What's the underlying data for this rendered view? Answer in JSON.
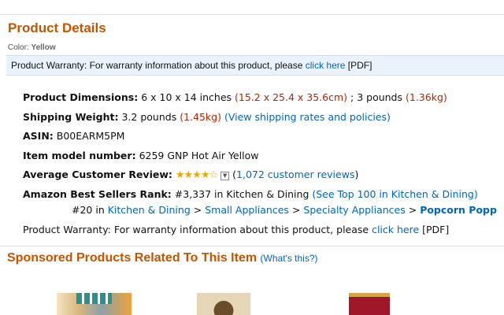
{
  "heading": "Product Details",
  "color": {
    "label": "Color:",
    "value": "Yellow"
  },
  "warranty_bar": {
    "prefix": "Product Warranty: For warranty information about this product, please",
    "link": "click here",
    "suffix": "[PDF]"
  },
  "details": {
    "dimensions": {
      "label": "Product Dimensions:",
      "value": "6 x 10 x 14 inches",
      "metric": "(15.2 x 25.4 x 35.6cm)",
      "sep": ";",
      "weight": "3 pounds",
      "weight_metric": "(1.36kg)"
    },
    "shipping": {
      "label": "Shipping Weight:",
      "value": "3.2 pounds",
      "metric": "(1.45kg)",
      "link": "(View shipping rates and policies)"
    },
    "asin": {
      "label": "ASIN:",
      "value": "B00EARM5PM"
    },
    "model": {
      "label": "Item model number:",
      "value": "6259 GNP Hot Air Yellow"
    },
    "review": {
      "label": "Average Customer Review:",
      "stars": "★★★★☆",
      "rating": 4,
      "count_prefix": "(",
      "count_link": "1,072 customer reviews",
      "count_suffix": ")"
    },
    "rank": {
      "label": "Amazon Best Sellers Rank:",
      "rank": "#3,337 in Kitchen & Dining",
      "link": "(See Top 100 in Kitchen & Dining)",
      "sub_rank": "#20 in",
      "cat1": "Kitchen & Dining",
      "cat2": "Small Appliances",
      "cat3": "Specialty Appliances",
      "cat4": "Popcorn Popp",
      "sep": ">"
    },
    "warranty": {
      "prefix": "Product Warranty: For warranty information about this product, please",
      "link": "click here",
      "suffix": "[PDF]"
    }
  },
  "sponsored": {
    "title": "Sponsored Products Related To This Item",
    "whats_this": "(What's this?)"
  },
  "colors": {
    "heading": "#c45500",
    "link": "#0066c0",
    "price_red": "#b12704",
    "stars": "#f0a500"
  }
}
